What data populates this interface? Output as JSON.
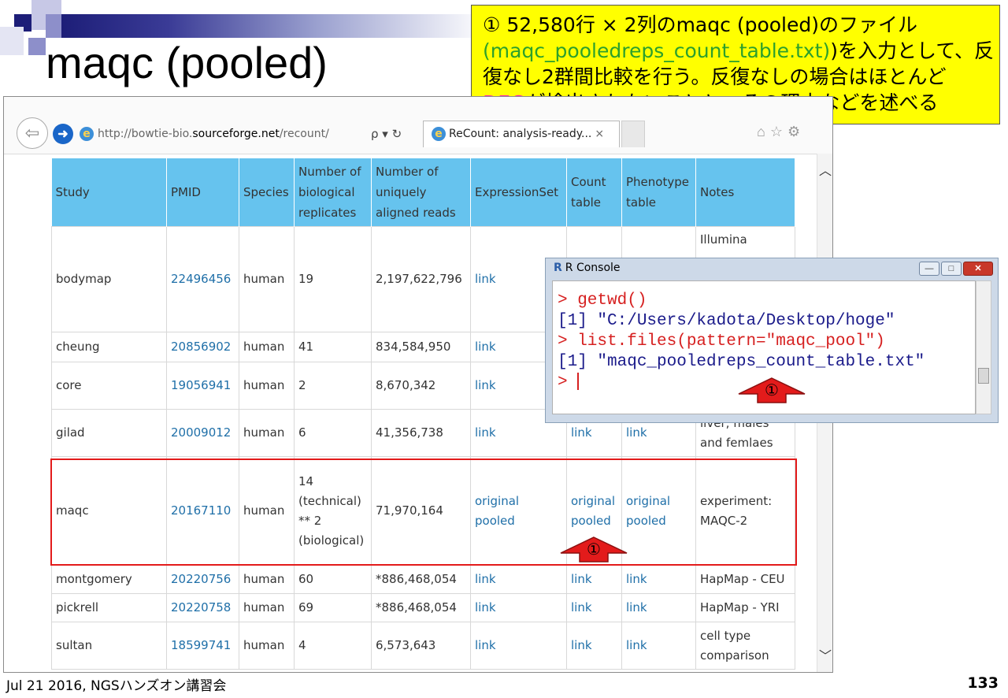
{
  "slide": {
    "title": "maqc (pooled)",
    "footer": "Jul 21 2016, NGSハンズオン講習会",
    "page_number": "133"
  },
  "callout": {
    "line1": "① 52,580行 × 2列のmaqc (pooled)のファイル",
    "line2_prefix": "(",
    "line2_file": "maqc_pooledreps_count_table.txt",
    "line2_rest": ")を入力として、反",
    "line3": "復なし2群間比較を行う。反復なしの場合はほとんど",
    "line4_deg": "DEG",
    "line4_rest": "が検出されないことと、その理由などを述べる"
  },
  "browser": {
    "url_prefix": "http://bowtie-bio.",
    "url_domain": "sourceforge.net",
    "url_suffix": "/recount/",
    "addr_controls": "ρ ▾ ↻",
    "tab_title": "ReCount: analysis-ready...",
    "tab_close": "×",
    "tool_icons": "⌂☆⚙"
  },
  "table": {
    "headers": [
      "Study",
      "PMID",
      "Species",
      "Number of biological replicates",
      "Number of uniquely aligned reads",
      "ExpressionSet",
      "Count table",
      "Phenotype table",
      "Notes"
    ],
    "rows": [
      {
        "study": "bodymap",
        "pmid": "22496456",
        "species": "human",
        "reps": "19",
        "reads": "2,197,622,796",
        "eset": "link",
        "count": "",
        "pheno": "",
        "notes": "Illumina"
      },
      {
        "study": "cheung",
        "pmid": "20856902",
        "species": "human",
        "reps": "41",
        "reads": "834,584,950",
        "eset": "link",
        "count": "",
        "pheno": "",
        "notes": ""
      },
      {
        "study": "core",
        "pmid": "19056941",
        "species": "human",
        "reps": "2",
        "reads": "8,670,342",
        "eset": "link",
        "count": "",
        "pheno": "",
        "notes": ""
      },
      {
        "study": "gilad",
        "pmid": "20009012",
        "species": "human",
        "reps": "6",
        "reads": "41,356,738",
        "eset": "link",
        "count": "link",
        "pheno": "link",
        "notes": "liver; males and femlaes"
      },
      {
        "study": "maqc",
        "pmid": "20167110",
        "species": "human",
        "reps": "14 (technical) ** 2 (biological)",
        "reads": "71,970,164",
        "eset": "original pooled",
        "count": "original pooled",
        "pheno": "original pooled",
        "notes": "experiment: MAQC-2"
      },
      {
        "study": "montgomery",
        "pmid": "20220756",
        "species": "human",
        "reps": "60",
        "reads": "*886,468,054",
        "eset": "link",
        "count": "link",
        "pheno": "link",
        "notes": "HapMap - CEU"
      },
      {
        "study": "pickrell",
        "pmid": "20220758",
        "species": "human",
        "reps": "69",
        "reads": "*886,468,054",
        "eset": "link",
        "count": "link",
        "pheno": "link",
        "notes": "HapMap - YRI"
      },
      {
        "study": "sultan",
        "pmid": "18599741",
        "species": "human",
        "reps": "4",
        "reads": "6,573,643",
        "eset": "link",
        "count": "link",
        "pheno": "link",
        "notes": "cell type comparison"
      }
    ]
  },
  "rconsole": {
    "title": "R Console",
    "lines": [
      {
        "text": "> getwd()",
        "kind": "input"
      },
      {
        "text": "[1] \"C:/Users/kadota/Desktop/hoge\"",
        "kind": "output"
      },
      {
        "text": "> list.files(pattern=\"maqc_pool\")",
        "kind": "input"
      },
      {
        "text": "[1] \"maqc_pooledreps_count_table.txt\"",
        "kind": "output"
      }
    ],
    "prompt": "> "
  },
  "annotations": {
    "marker": "①",
    "color": "#e31b1b"
  }
}
